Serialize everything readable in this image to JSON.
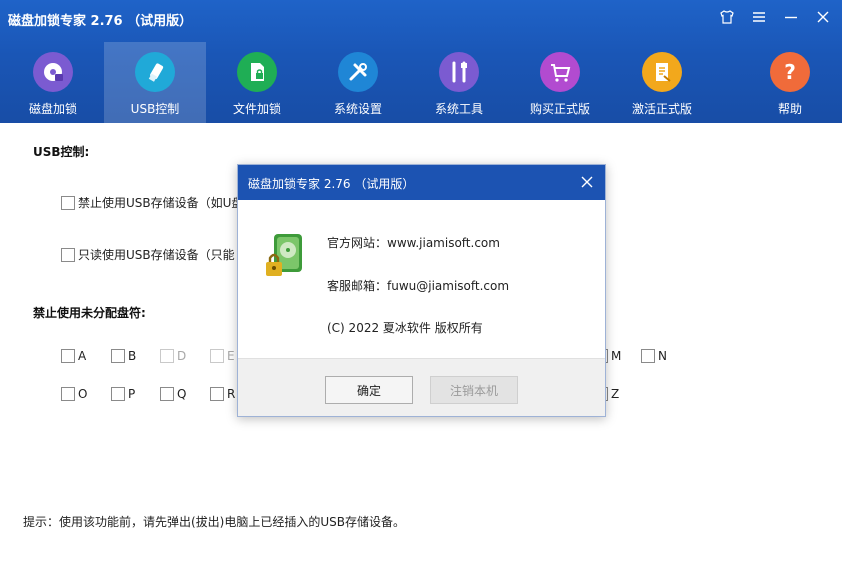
{
  "app": {
    "title": "磁盘加锁专家 2.76 （试用版）"
  },
  "window_controls": [
    "shirt-icon",
    "menu-icon",
    "minimize-icon",
    "close-icon"
  ],
  "tabs": [
    {
      "label": "磁盘加锁",
      "icon": "disk-lock-icon",
      "color": "#7b5bd1"
    },
    {
      "label": "USB控制",
      "icon": "usb-icon",
      "color": "#20a9d8",
      "active": true
    },
    {
      "label": "文件加锁",
      "icon": "file-lock-icon",
      "color": "#1fae55"
    },
    {
      "label": "系统设置",
      "icon": "tools-icon",
      "color": "#1f86d6"
    },
    {
      "label": "系统工具",
      "icon": "wrench-icon",
      "color": "#7b5bd1"
    },
    {
      "label": "购买正式版",
      "icon": "cart-icon",
      "color": "#b24bd0"
    },
    {
      "label": "激活正式版",
      "icon": "activate-icon",
      "color": "#f2a81c"
    },
    {
      "label": "帮助",
      "icon": "help-icon",
      "color": "#f06b3a"
    }
  ],
  "usb": {
    "section_title": "USB控制:",
    "option1": "禁止使用USB存储设备（如U盘",
    "option2": "只读使用USB存储设备（只能",
    "drives_title": "禁止使用未分配盘符:",
    "drives_row1": [
      "A",
      "B",
      "D",
      "E",
      "M",
      "N"
    ],
    "drives_row2": [
      "O",
      "P",
      "Q",
      "R",
      "Z"
    ],
    "tip": "提示：使用该功能前，请先弹出(拔出)电脑上已经插入的USB存储设备。"
  },
  "dialog": {
    "title": "磁盘加锁专家 2.76 （试用版）",
    "website": "官方网站：www.jiamisoft.com",
    "email": "客服邮箱：fuwu@jiamisoft.com",
    "copyright": "(C)  2022 夏冰软件 版权所有",
    "ok_label": "确定",
    "logout_label": "注销本机"
  }
}
